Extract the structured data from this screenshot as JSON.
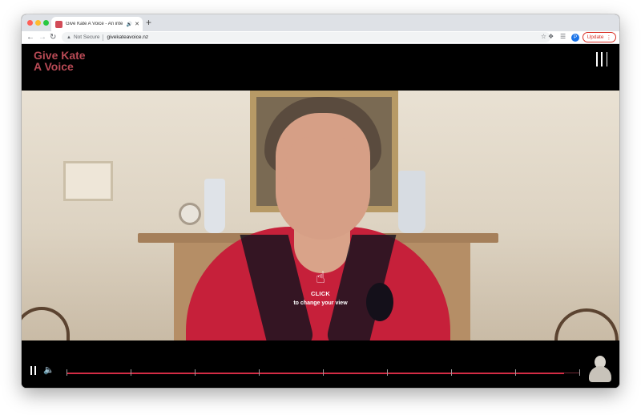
{
  "browser": {
    "tab": {
      "title": "Give Kate A Voice - An inte",
      "audio_icon": "speaker-icon",
      "close_icon": "close-icon"
    },
    "toolbar": {
      "security_label": "Not Secure",
      "url": "givekateavoice.nz",
      "profile_initial": "P",
      "update_label": "Update"
    }
  },
  "site": {
    "brand_line1": "Give Kate",
    "brand_line2": "A Voice"
  },
  "video": {
    "overlay_title": "CLICK",
    "overlay_subtitle": "to change your view"
  },
  "player": {
    "progress_fraction": 0.97,
    "chapter_ticks": 8,
    "accent_color": "#d42c45",
    "track_color": "#6f2734"
  },
  "colors": {
    "brand": "#b94a55",
    "update_red": "#d93025"
  }
}
